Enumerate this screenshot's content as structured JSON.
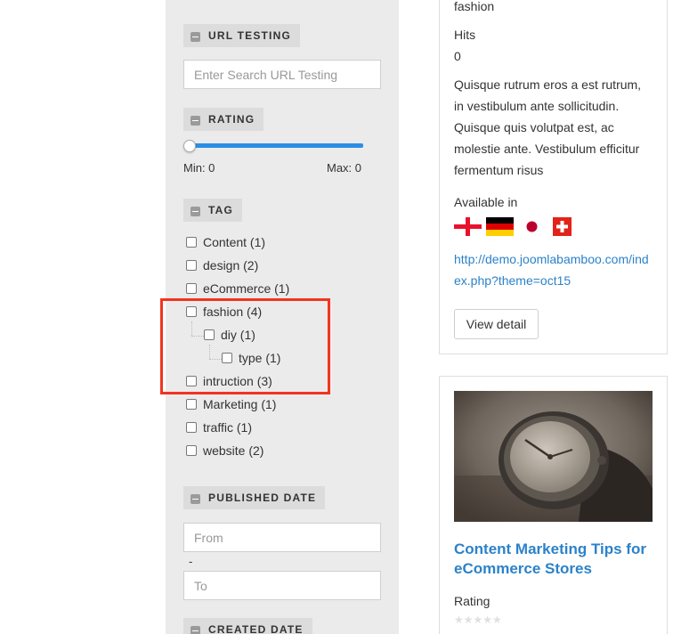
{
  "filters": {
    "url_testing": {
      "title": "URL TESTING",
      "placeholder": "Enter Search URL Testing"
    },
    "rating": {
      "title": "RATING",
      "min_label": "Min: 0",
      "max_label": "Max: 0",
      "slider_value": 0
    },
    "tag": {
      "title": "TAG",
      "items": [
        {
          "label": "Content (1)"
        },
        {
          "label": "design (2)"
        },
        {
          "label": "eCommerce (1)"
        },
        {
          "label": "fashion (4)"
        },
        {
          "label": "diy (1)"
        },
        {
          "label": "type (1)"
        },
        {
          "label": "intruction (3)"
        },
        {
          "label": "Marketing (1)"
        },
        {
          "label": "traffic (1)"
        },
        {
          "label": "website (2)"
        }
      ]
    },
    "published_date": {
      "title": "PUBLISHED DATE",
      "from_placeholder": "From",
      "separator": "-",
      "to_placeholder": "To"
    },
    "created_date": {
      "title": "CREATED DATE"
    }
  },
  "card1": {
    "tag_value": "fashion",
    "hits_label": "Hits",
    "hits_value": "0",
    "description": "Quisque rutrum eros a est rutrum, in vestibulum ante sollicitudin. Quisque quis volutpat est, ac molestie ante. Vestibulum efficitur fermentum risus",
    "available_label": "Available in",
    "flags": [
      "england-flag",
      "germany-flag",
      "japan-flag",
      "switzerland-flag"
    ],
    "url": "http://demo.joomlabamboo.com/index.php?theme=oct15",
    "view_button": "View detail"
  },
  "card2": {
    "image": "wristwatch-photo",
    "title": "Content Marketing Tips for eCommerce Stores",
    "rating_label": "Rating",
    "stars": "★★★★★",
    "rating_value": 0
  },
  "colors": {
    "accent": "#2b8ee4",
    "link": "#2b82c9",
    "highlight": "#f2341f",
    "panel": "#ebebeb"
  }
}
